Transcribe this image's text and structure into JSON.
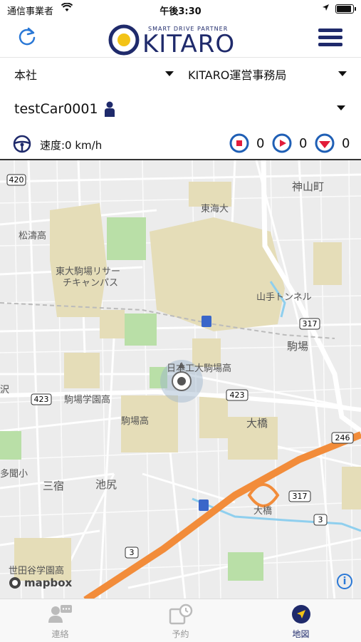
{
  "status_bar": {
    "carrier": "通信事業者",
    "time": "午後3:30"
  },
  "header": {
    "logo_tagline": "SMART DRIVE PARTNER",
    "logo_text": "KITARO",
    "colors": {
      "brand": "#1f2a6b",
      "accent": "#f3c316",
      "refresh": "#2a78d6"
    }
  },
  "selectors": {
    "branch": "本社",
    "office": "KITARO運営事務局"
  },
  "vehicle": {
    "name": "testCar0001"
  },
  "info": {
    "speed": "速度:0 km/h",
    "counts": [
      {
        "icon": "stop-icon",
        "value": "0"
      },
      {
        "icon": "play-icon",
        "value": "0"
      },
      {
        "icon": "alert-icon",
        "value": "0"
      }
    ]
  },
  "map": {
    "labels": {
      "kamiyama": "神山町",
      "tokaidai": "東海大",
      "shoto": "松濤高",
      "todai": "東大駒場リサー",
      "todai2": "チキャンパス",
      "yamate": "山手トンネル",
      "komaba": "駒場",
      "nikodai": "日本工大駒場高",
      "komagaku": "駒場学園高",
      "komabako": "駒場高",
      "ohashi": "大橋",
      "ohashi2": "大橋",
      "sangenjaya": "三宿",
      "ikejiri": "池尻",
      "tabunko": "多聞小",
      "setagaku": "世田谷学園高",
      "shi": "沢"
    },
    "routes": {
      "r420": "420",
      "r317a": "317",
      "r423a": "423",
      "r423b": "423",
      "r246": "246",
      "r317b": "317",
      "r3a": "3",
      "r3b": "3"
    },
    "attribution": "mapbox",
    "info": "i"
  },
  "tabs": [
    {
      "label": "連絡"
    },
    {
      "label": "予約"
    },
    {
      "label": "地図"
    }
  ]
}
